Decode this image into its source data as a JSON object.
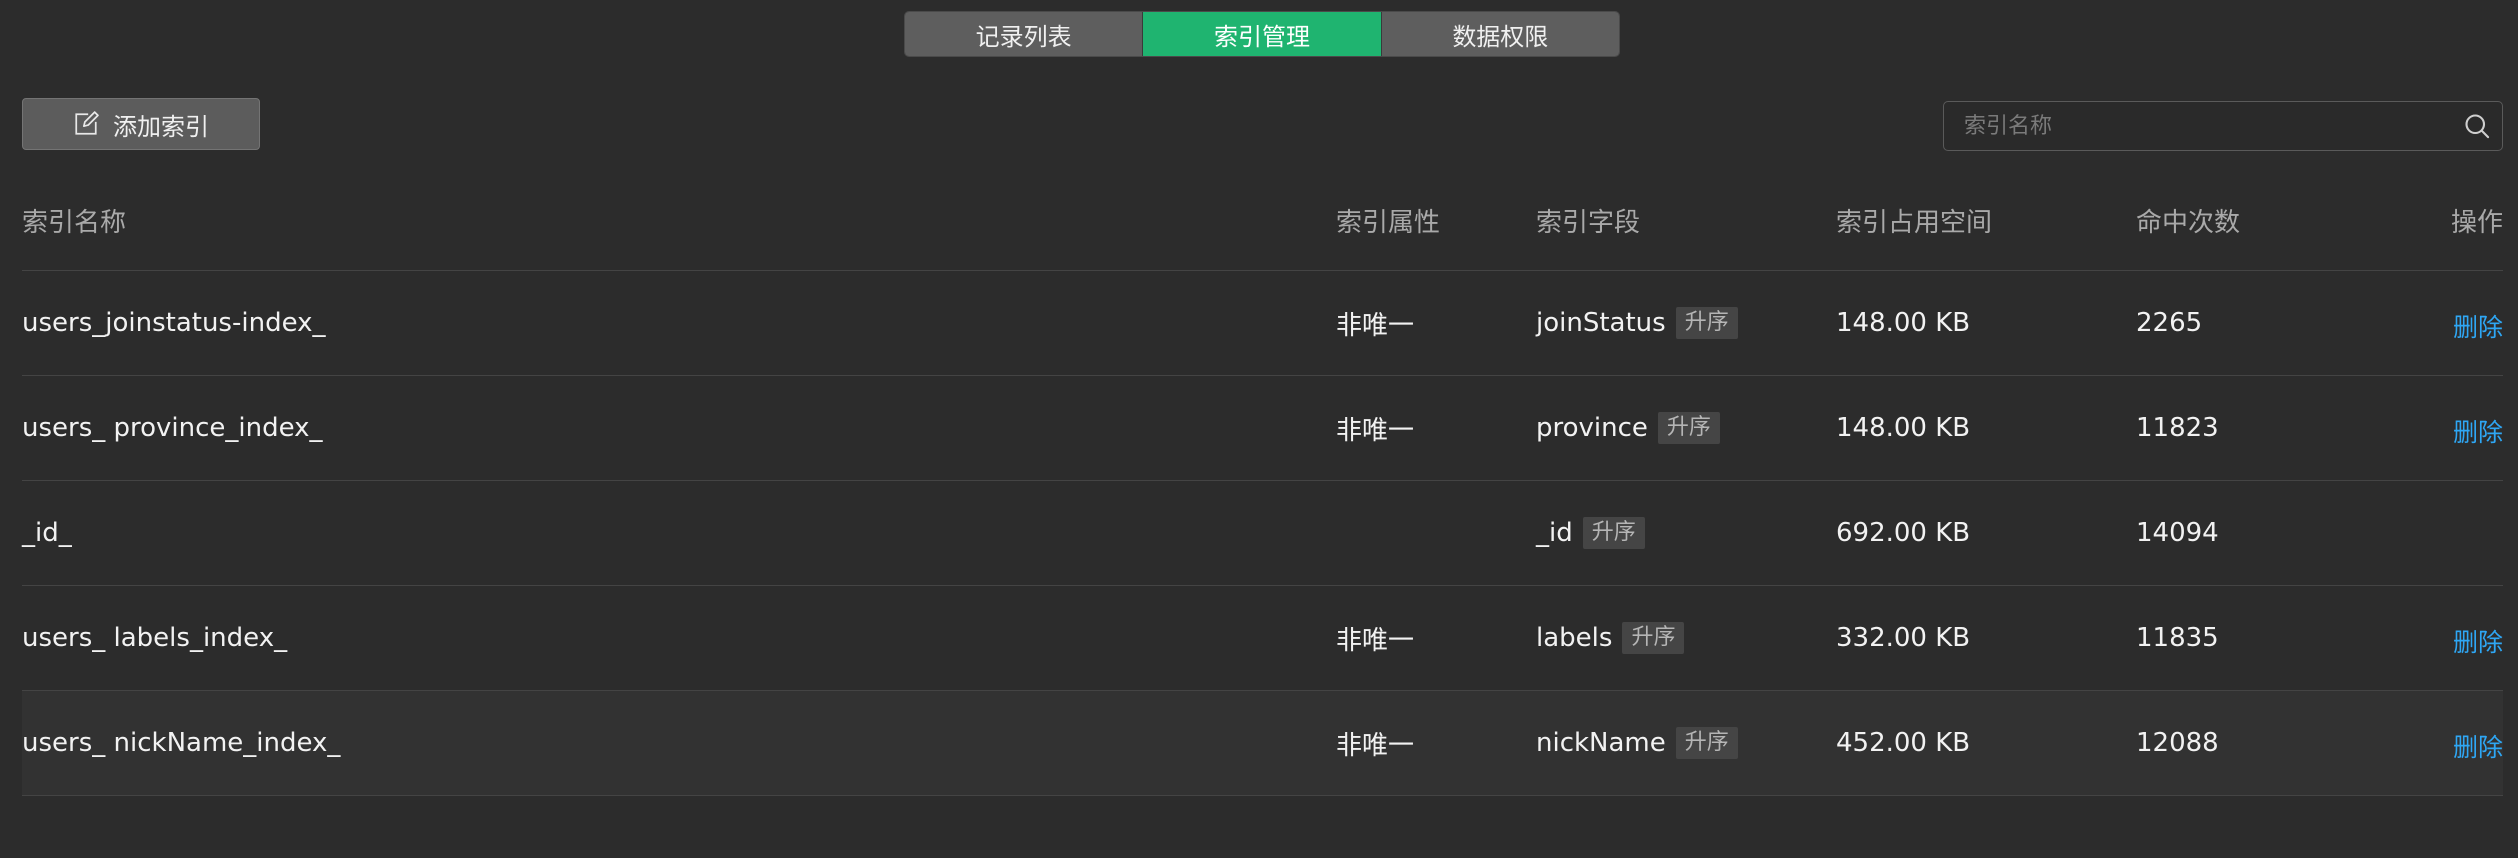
{
  "tabs": [
    {
      "label": "记录列表",
      "active": false
    },
    {
      "label": "索引管理",
      "active": true
    },
    {
      "label": "数据权限",
      "active": false
    }
  ],
  "toolbar": {
    "add_label": "添加索引",
    "add_icon": "edit-icon"
  },
  "search": {
    "placeholder": "索引名称",
    "value": "",
    "icon": "search-icon"
  },
  "table": {
    "columns": [
      "索引名称",
      "索引属性",
      "索引字段",
      "索引占用空间",
      "命中次数",
      "操作"
    ],
    "rows": [
      {
        "name": "users_joinstatus-index_",
        "attr": "非唯一",
        "field": "joinStatus",
        "order": "升序",
        "size": "148.00 KB",
        "hits": "2265",
        "action": "删除"
      },
      {
        "name": "users_ province_index_",
        "attr": "非唯一",
        "field": "province",
        "order": "升序",
        "size": "148.00 KB",
        "hits": "11823",
        "action": "删除"
      },
      {
        "name": "_id_",
        "attr": "",
        "field": "_id",
        "order": "升序",
        "size": "692.00 KB",
        "hits": "14094",
        "action": ""
      },
      {
        "name": "users_ labels_index_",
        "attr": "非唯一",
        "field": "labels",
        "order": "升序",
        "size": "332.00 KB",
        "hits": "11835",
        "action": "删除"
      },
      {
        "name": "users_ nickName_index_",
        "attr": "非唯一",
        "field": "nickName",
        "order": "升序",
        "size": "452.00 KB",
        "hits": "12088",
        "action": "删除"
      }
    ]
  },
  "colors": {
    "accent": "#1fb470",
    "link": "#2ea7f5",
    "background": "#2c2c2c"
  }
}
